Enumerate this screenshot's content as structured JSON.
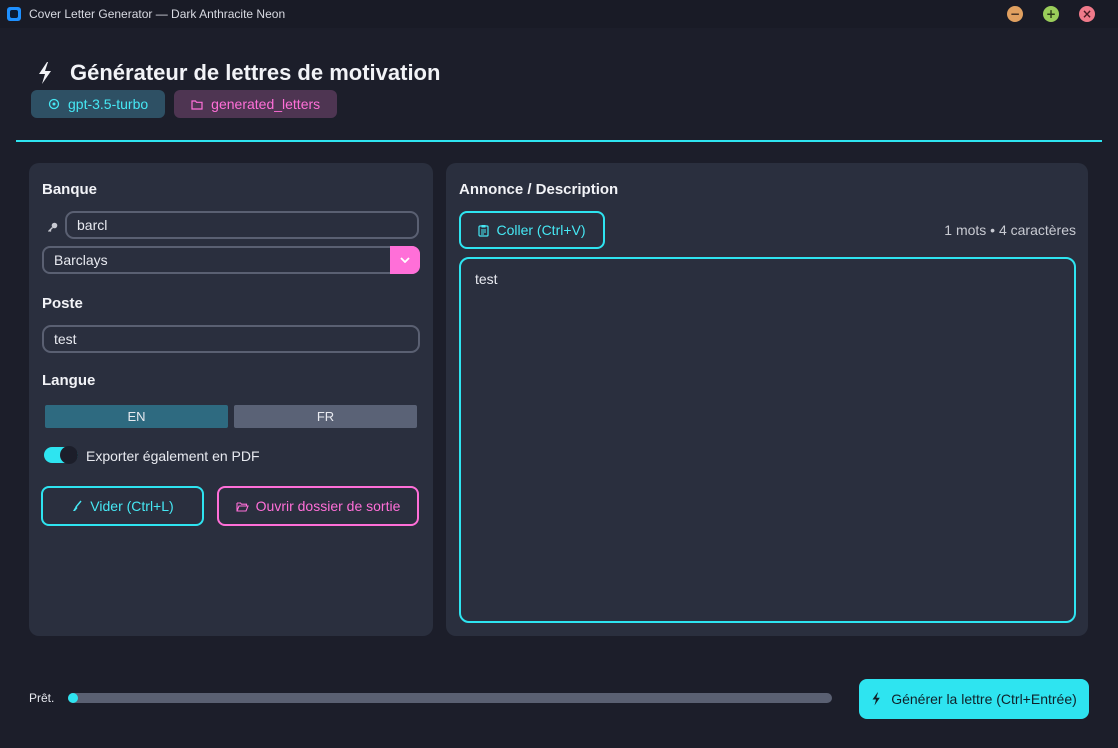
{
  "window": {
    "title": "Cover Letter Generator — Dark Anthracite Neon",
    "controls": [
      "minimize-icon",
      "maximize-icon",
      "close-icon"
    ]
  },
  "header": {
    "title": "Générateur de lettres de motivation",
    "icon": "bolt-icon",
    "model_pill": "gpt-3.5-turbo",
    "folder_pill": "generated_letters"
  },
  "left": {
    "bank_label": "Banque",
    "bank_search_value": "barcl",
    "bank_selected": "Barclays",
    "position_label": "Poste",
    "position_value": "test",
    "language_label": "Langue",
    "lang_en": "EN",
    "lang_fr": "FR",
    "lang_selected": "EN",
    "pdf_export_label": "Exporter également en PDF",
    "pdf_export_enabled": true,
    "clear_button": "Vider (Ctrl+L)",
    "open_folder_button": "Ouvrir dossier de sortie"
  },
  "right": {
    "label": "Annonce / Description",
    "paste_button": "Coller (Ctrl+V)",
    "counter": "1 mots • 4 caractères",
    "description_value": "test"
  },
  "footer": {
    "status": "Prêt.",
    "progress": 0,
    "generate_button": "Générer la lettre (Ctrl+Entrée)"
  },
  "colors": {
    "accent_cyan": "#2ee4f0",
    "accent_pink": "#ff6fd8",
    "background": "#1c1e2a",
    "panel": "#2a2f3e"
  }
}
